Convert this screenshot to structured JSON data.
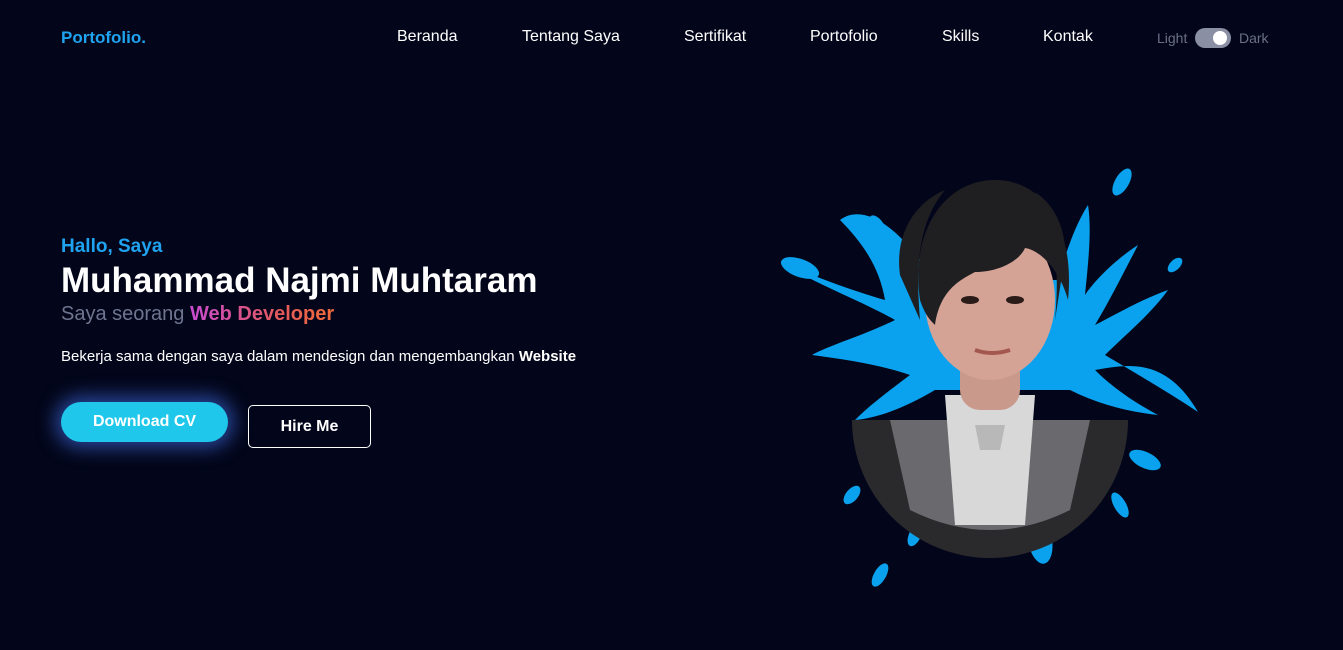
{
  "nav": {
    "brand": "Portofolio.",
    "links": [
      "Beranda",
      "Tentang Saya",
      "Sertifikat",
      "Portofolio",
      "Skills",
      "Kontak"
    ],
    "theme_light": "Light",
    "theme_dark": "Dark",
    "theme_mode": "dark"
  },
  "hero": {
    "greeting": "Hallo, Saya",
    "name": "Muhammad Najmi Muhtaram",
    "tagline_prefix": "Saya seorang",
    "role": "Web Developer",
    "description": "Bekerja sama dengan saya dalam mendesign dan mengembangkan",
    "description_bold": "Website",
    "download_label": "Download CV",
    "hire_label": "Hire Me"
  },
  "colors": {
    "background": "#03061a",
    "accent": "#1fa3f0",
    "button": "#1fc7ea",
    "splash": "#0aa2ee"
  },
  "icons": {
    "profile": "profile-photo",
    "splash": "paint-splash"
  }
}
